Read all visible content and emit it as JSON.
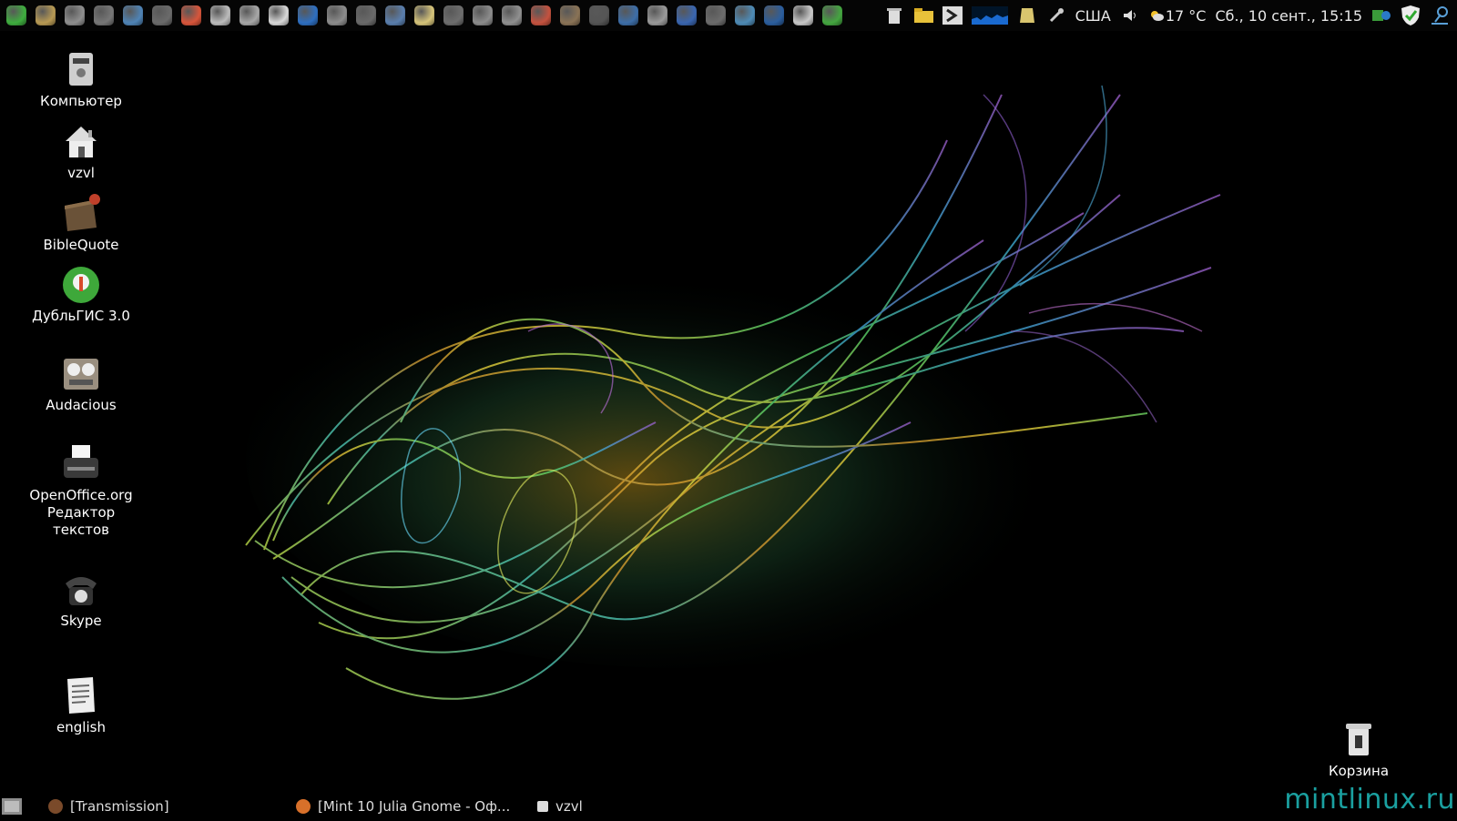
{
  "top_panel": {
    "launchers": [
      {
        "icon": "mint-menu-icon",
        "color": "#3fae3f"
      },
      {
        "icon": "file-manager-icon",
        "color": "#b89a54"
      },
      {
        "icon": "audio-player-icon",
        "color": "#8f8f8f"
      },
      {
        "icon": "settings-dial-icon",
        "color": "#777777"
      },
      {
        "icon": "globe-browser-icon",
        "color": "#4f84b6"
      },
      {
        "icon": "camera-icon",
        "color": "#6b6b6b"
      },
      {
        "icon": "picasa-icon",
        "color": "#d8553b"
      },
      {
        "icon": "cloud-icon",
        "color": "#bcbcbc"
      },
      {
        "icon": "document-icon",
        "color": "#a8a8a8"
      },
      {
        "icon": "home-icon",
        "color": "#d9d9d9"
      },
      {
        "icon": "thermometer-icon",
        "color": "#2e6fc1"
      },
      {
        "icon": "eye-icon",
        "color": "#8d8d8d"
      },
      {
        "icon": "window-icon",
        "color": "#6a6a6a"
      },
      {
        "icon": "aperture-icon",
        "color": "#5a7fae"
      },
      {
        "icon": "text-editor-icon",
        "color": "#d6c47a"
      },
      {
        "icon": "typewriter-icon",
        "color": "#6e6e6e"
      },
      {
        "icon": "tape-recorder-icon",
        "color": "#8c8c8c"
      },
      {
        "icon": "package-icon",
        "color": "#909090"
      },
      {
        "icon": "cards-icon",
        "color": "#c5523f"
      },
      {
        "icon": "bird-icon",
        "color": "#8a7356"
      },
      {
        "icon": "terminal-icon",
        "color": "#555555"
      },
      {
        "icon": "monitor-icon",
        "color": "#3d6ea8"
      },
      {
        "icon": "tools-icon",
        "color": "#9a9a9a"
      },
      {
        "icon": "shield-icon",
        "color": "#3a66b0"
      },
      {
        "icon": "calculator-icon",
        "color": "#6c6c6c"
      },
      {
        "icon": "cylinder-icon",
        "color": "#4e8bb6"
      },
      {
        "icon": "refresh-icon",
        "color": "#2b5e9e"
      },
      {
        "icon": "printer-icon",
        "color": "#c9c9c9"
      },
      {
        "icon": "dublgis-icon",
        "color": "#44a640"
      }
    ],
    "tray": {
      "keyboard_layout": "США",
      "weather": "17 °C",
      "clock": "Сб., 10 сент., 15:15"
    }
  },
  "desktop": {
    "icons": [
      {
        "label": "Компьютер",
        "icon": "computer-icon"
      },
      {
        "label": "vzvl",
        "icon": "home-folder-icon"
      },
      {
        "label": "BibleQuote",
        "icon": "bible-folder-icon"
      },
      {
        "label": "ДубльГИС 3.0",
        "icon": "dublgis-icon"
      },
      {
        "label": "Audacious",
        "icon": "audacious-icon"
      },
      {
        "label": "OpenOffice.org Редактор текстов",
        "icon": "openoffice-writer-icon"
      },
      {
        "label": "Skype",
        "icon": "skype-phone-icon"
      },
      {
        "label": "english",
        "icon": "text-document-icon"
      }
    ],
    "trash_label": "Корзина"
  },
  "bottom_panel": {
    "tasks": [
      {
        "label": "[Transmission]",
        "icon": "transmission-icon"
      },
      {
        "label": "[Mint 10 Julia Gnome - Оф...",
        "icon": "firefox-icon"
      },
      {
        "label": "vzvl",
        "icon": "home-folder-icon"
      }
    ]
  },
  "watermark": "mintlinux.ru"
}
